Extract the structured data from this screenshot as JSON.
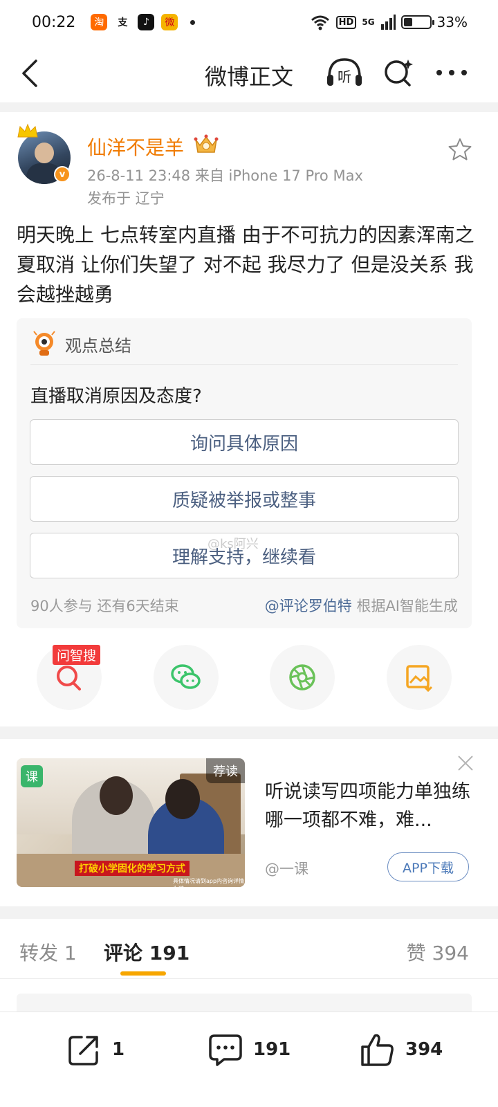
{
  "status_bar": {
    "time": "00:22",
    "apps": [
      {
        "icon": "taobao-icon",
        "glyph": "淘",
        "color": "#ff6a00"
      },
      {
        "icon": "alipay-icon",
        "glyph": "支",
        "color": "#ffffff"
      },
      {
        "icon": "tiktok-icon",
        "glyph": "♪",
        "color": "#111111"
      },
      {
        "icon": "weibo-icon",
        "glyph": "微",
        "color": "#f5b400"
      }
    ],
    "hd": "HD",
    "network": "5G",
    "battery_level": 0.33,
    "battery": "33%"
  },
  "nav": {
    "title": "微博正文",
    "listen_label": "听"
  },
  "post": {
    "username": "仙洋不是羊",
    "time_source": "26-8-11 23:48  来自 iPhone 17 Pro Max",
    "location": "发布于 辽宁",
    "text": "明天晚上 七点转室内直播 由于不可抗力的因素浑南之夏取消 让你们失望了 对不起 我尽力了 但是没关系 我会越挫越勇",
    "verified_badge": "v"
  },
  "summary_card": {
    "title": "观点总结",
    "question": "直播取消原因及态度?",
    "options": [
      "询问具体原因",
      "质疑被举报或整事",
      "理解支持，继续看"
    ],
    "participants": "90人参与  还有6天结束",
    "generated_by_mention": "@评论罗伯特",
    "generated_by_suffix": " 根据AI智能生成"
  },
  "watermark": "@ks阿兴",
  "share_row": {
    "search_tag": "问智搜",
    "items": [
      "search-icon",
      "wechat-icon",
      "moments-icon",
      "save-image-icon"
    ],
    "colors": {
      "search": "#f04a4a",
      "wechat": "#3cc46b",
      "moments": "#6ac259",
      "save": "#f5a623"
    }
  },
  "ad": {
    "badge": "课",
    "recommend": "荐读",
    "caption": "打破小学固化的学习方式",
    "small_caption": "具体情况请到app内咨询详情为准",
    "title": "听说读写四项能力单独练哪一项都不难，难...",
    "source": "@一课",
    "button": "APP下载"
  },
  "tabs": {
    "forward": "转发 1",
    "comment": "评论 191",
    "like": "赞 394",
    "accent": "#f7a600"
  },
  "bottom_bar": {
    "share_count": "1",
    "comment_count": "191",
    "like_count": "394"
  }
}
